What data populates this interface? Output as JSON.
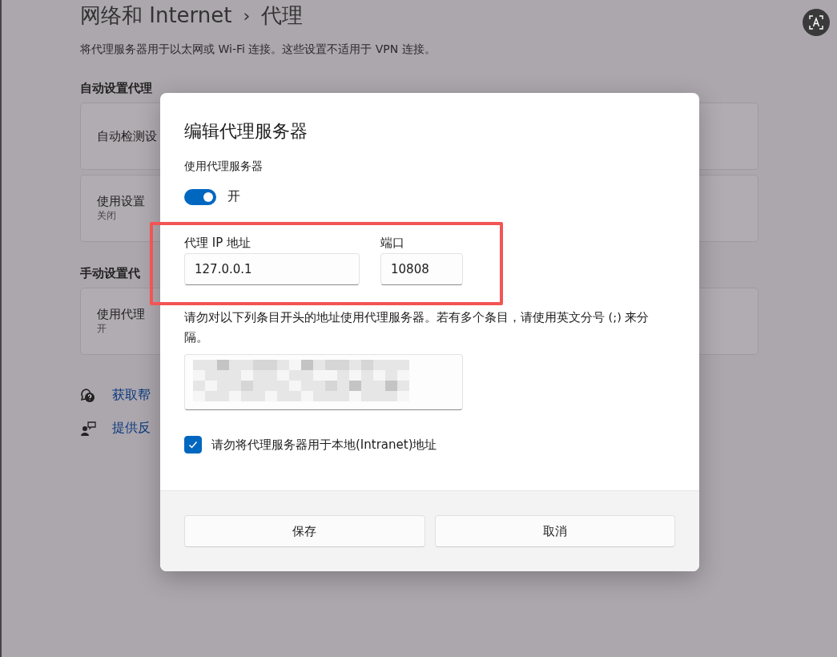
{
  "page": {
    "breadcrumb": "网络和 Internet",
    "separator": "›",
    "title": "代理",
    "description": "将代理服务器用于以太网或 Wi-Fi 连接。这些设置不适用于 VPN 连接。",
    "sections": [
      {
        "heading": "自动设置代理",
        "cards": [
          {
            "label": "自动检测设"
          },
          {
            "label": "使用设置",
            "status": "关闭"
          }
        ]
      },
      {
        "heading": "手动设置代",
        "cards": [
          {
            "label": "使用代理",
            "status": "开"
          }
        ]
      }
    ],
    "links": [
      {
        "kind": "help",
        "label": "获取帮"
      },
      {
        "kind": "feedback",
        "label": "提供反"
      }
    ]
  },
  "dialog": {
    "title": "编辑代理服务器",
    "toggle_label": "使用代理服务器",
    "toggle": {
      "on": true,
      "state_text": "开"
    },
    "ip_field": {
      "label": "代理 IP 地址",
      "value": "127.0.0.1"
    },
    "port_field": {
      "label": "端口",
      "value": "10808"
    },
    "exceptions_description": "请勿对以下列条目开头的地址使用代理服务器。若有多个条目，请使用英文分号 (;) 来分隔。",
    "local_checkbox": {
      "label": "请勿将代理服务器用于本地(Intranet)地址",
      "checked": true
    },
    "buttons": [
      {
        "label": "保存"
      },
      {
        "label": "取消"
      }
    ]
  }
}
